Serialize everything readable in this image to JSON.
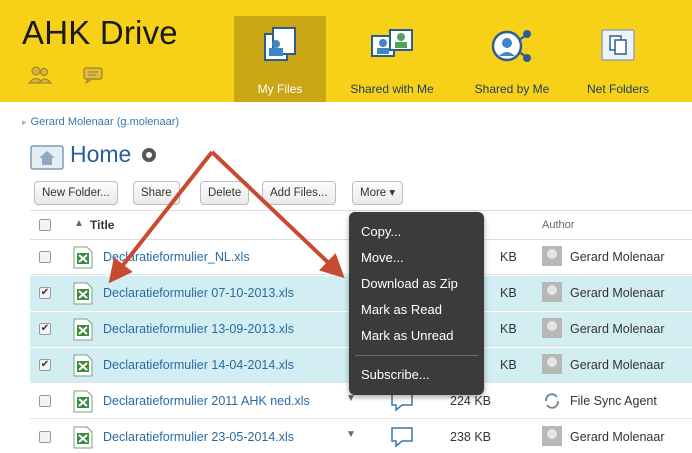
{
  "app": {
    "brand": "AHK Drive"
  },
  "nav": {
    "tabs": [
      {
        "label": "My Files",
        "icon": "my-files-icon",
        "active": true
      },
      {
        "label": "Shared with Me",
        "icon": "shared-with-me-icon",
        "active": false
      },
      {
        "label": "Shared by Me",
        "icon": "shared-by-me-icon",
        "active": false
      },
      {
        "label": "Net Folders",
        "icon": "net-folders-icon",
        "active": false
      }
    ]
  },
  "breadcrumb": "Gerard Molenaar (g.molenaar)",
  "page": {
    "title": "Home"
  },
  "toolbar": {
    "new_folder": "New Folder...",
    "share": "Share",
    "delete": "Delete",
    "add_files": "Add Files...",
    "more": "More ▾"
  },
  "table": {
    "columns": {
      "title": "Title",
      "author": "Author"
    },
    "rows": [
      {
        "name": "Declaratieformulier_NL.xls",
        "size": "KB",
        "author": "Gerard Molenaar",
        "selected": false
      },
      {
        "name": "Declaratieformulier 07-10-2013.xls",
        "size": "KB",
        "author": "Gerard Molenaar",
        "selected": true
      },
      {
        "name": "Declaratieformulier 13-09-2013.xls",
        "size": "KB",
        "author": "Gerard Molenaar",
        "selected": true
      },
      {
        "name": "Declaratieformulier 14-04-2014.xls",
        "size": "KB",
        "author": "Gerard Molenaar",
        "selected": true
      },
      {
        "name": "Declaratieformulier 2011 AHK ned.xls",
        "size": "224 KB",
        "author": "File Sync Agent",
        "selected": false
      },
      {
        "name": "Declaratieformulier 23-05-2014.xls",
        "size": "238 KB",
        "author": "Gerard Molenaar",
        "selected": false
      }
    ]
  },
  "menu": {
    "items": [
      "Copy...",
      "Move...",
      "Download as Zip",
      "Mark as Read",
      "Mark as Unread"
    ],
    "footer_item": "Subscribe..."
  },
  "colors": {
    "topbar": "#f7d117",
    "active_tab": "#caa514",
    "link": "#2a6aa0",
    "selected_row": "#d3eef3",
    "menu_bg": "#3b3b3b",
    "annotation_arrow": "#c94a33"
  }
}
